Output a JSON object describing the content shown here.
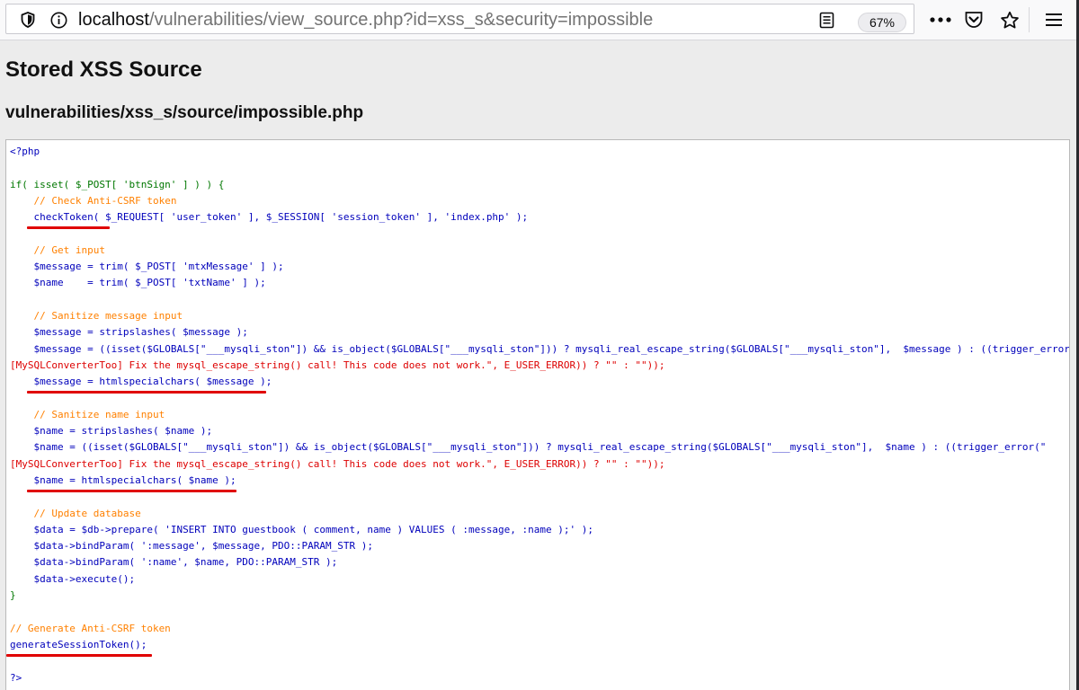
{
  "browser": {
    "url_host": "localhost",
    "url_path": "/vulnerabilities/view_source.php?id=xss_s&security=impossible",
    "zoom": "67%",
    "icons": [
      "shield-icon",
      "info-icon",
      "reader-view-icon",
      "more-icon",
      "pocket-icon",
      "bookmark-star-icon",
      "menu-icon"
    ]
  },
  "page": {
    "title": "Stored XSS Source",
    "file_path": "vulnerabilities/xss_s/source/impossible.php"
  },
  "code": {
    "line_open": "<?php",
    "line_if": "if( isset( $_POST[ 'btnSign' ] ) ) {",
    "cm_csrf": "// Check Anti-CSRF token",
    "line_check": "checkToken( $_REQUEST[ 'user_token' ], $_SESSION[ 'session_token' ], 'index.php' );",
    "cm_input": "// Get input",
    "line_msg_trim": "$message = trim( $_POST[ 'mtxMessage' ] );",
    "line_name_trim": "$name    = trim( $_POST[ 'txtName' ] );",
    "cm_san_msg": "// Sanitize message input",
    "line_msg_strip": "$message = stripslashes( $message );",
    "line_msg_esc_a": "$message = ((isset($GLOBALS[\"___mysqli_ston\"]) && is_object($GLOBALS[\"___mysqli_ston\"])) ? mysqli_real_escape_string($GLOBALS[\"___mysqli_ston\"],  $message ) : ((trigger_error(\"",
    "line_msg_esc_b": "[MySQLConverterToo] Fix the mysql_escape_string() call! This code does not work.\", E_USER_ERROR)) ? \"\" : \"\"));",
    "line_msg_html": "$message = htmlspecialchars( $message );",
    "cm_san_name": "// Sanitize name input",
    "line_name_strip": "$name = stripslashes( $name );",
    "line_name_esc_a": "$name = ((isset($GLOBALS[\"___mysqli_ston\"]) && is_object($GLOBALS[\"___mysqli_ston\"])) ? mysqli_real_escape_string($GLOBALS[\"___mysqli_ston\"],  $name ) : ((trigger_error(\"",
    "line_name_esc_b": "[MySQLConverterToo] Fix the mysql_escape_string() call! This code does not work.\", E_USER_ERROR)) ? \"\" : \"\"));",
    "line_name_html": "$name = htmlspecialchars( $name );",
    "cm_update": "// Update database",
    "line_prepare": "$data = $db->prepare( 'INSERT INTO guestbook ( comment, name ) VALUES ( :message, :name );' );",
    "line_bind_msg": "$data->bindParam( ':message', $message, PDO::PARAM_STR );",
    "line_bind_name": "$data->bindParam( ':name', $name, PDO::PARAM_STR );",
    "line_execute": "$data->execute();",
    "line_close_brace": "}",
    "cm_generate": "// Generate Anti-CSRF token",
    "line_generate": "generateSessionToken();",
    "line_close": "?>"
  },
  "colors": {
    "underline": "#e00000",
    "php_default": "#0000bb",
    "php_keyword": "#007700",
    "php_comment": "#ff8000",
    "php_string": "#dd0000"
  }
}
